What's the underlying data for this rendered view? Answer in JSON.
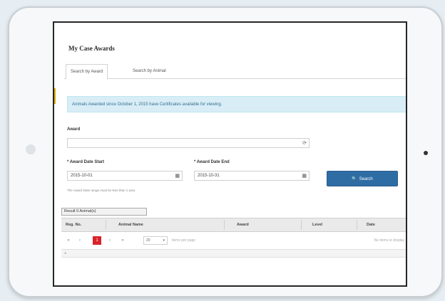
{
  "page": {
    "title": "My Case Awards",
    "tabs": [
      {
        "label": "Search by Award",
        "active": true
      },
      {
        "label": "Search by Animal",
        "active": false
      }
    ],
    "alert": "Animals Awarded since October 1, 2015 have Certificates available for viewing.",
    "award_field": {
      "label": "Award",
      "value": "",
      "icon": "refresh-icon"
    },
    "date_start": {
      "label": "* Award Date Start",
      "value": "2015-10-01",
      "icon": "calendar-icon"
    },
    "date_end": {
      "label": "* Award Date End",
      "value": "2015-10-31",
      "icon": "calendar-icon"
    },
    "hint": "The Award Date range must be less than 1 year.",
    "search_button": {
      "label": "Search",
      "icon": "search-icon"
    },
    "result_label": "Result 0 Animal(s)",
    "columns": [
      "Reg. No.",
      "Animal Name",
      "Award",
      "Level",
      "Date"
    ],
    "pager": {
      "first": "«",
      "prev": "‹",
      "current": "1",
      "next": "›",
      "last": "»",
      "per_page_value": "20",
      "per_page_text": "items per page",
      "no_items": "No items to display"
    },
    "accent_color": "#e0a800",
    "alert_bg": "#d9edf7",
    "button_color": "#2e6da4",
    "pager_current_color": "#d9222a"
  }
}
